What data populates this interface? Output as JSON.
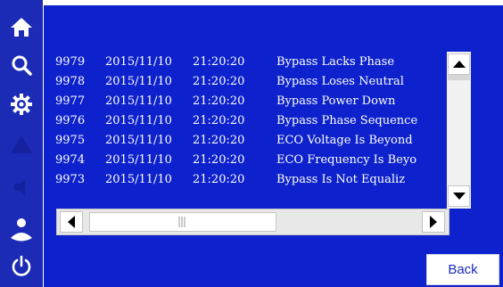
{
  "sidebar": {
    "items": [
      {
        "name": "home",
        "icon": "home-icon"
      },
      {
        "name": "search",
        "icon": "search-icon"
      },
      {
        "name": "settings",
        "icon": "gear-icon"
      },
      {
        "name": "alarm",
        "icon": "warning-icon"
      },
      {
        "name": "mute",
        "icon": "speaker-icon"
      },
      {
        "name": "user",
        "icon": "user-icon"
      },
      {
        "name": "power",
        "icon": "power-icon"
      }
    ]
  },
  "log": {
    "entries": [
      {
        "id": "9979",
        "date": "2015/11/10",
        "time": "21:20:20",
        "event": "Bypass Lacks Phase"
      },
      {
        "id": "9978",
        "date": "2015/11/10",
        "time": "21:20:20",
        "event": "Bypass Loses Neutral"
      },
      {
        "id": "9977",
        "date": "2015/11/10",
        "time": "21:20:20",
        "event": "Bypass Power Down"
      },
      {
        "id": "9976",
        "date": "2015/11/10",
        "time": "21:20:20",
        "event": "Bypass Phase Sequence"
      },
      {
        "id": "9975",
        "date": "2015/11/10",
        "time": "21:20:20",
        "event": "ECO Voltage Is Beyond"
      },
      {
        "id": "9974",
        "date": "2015/11/10",
        "time": "21:20:20",
        "event": "ECO Frequency Is Beyo"
      },
      {
        "id": "9973",
        "date": "2015/11/10",
        "time": "21:20:20",
        "event": "Bypass Is Not Equaliz"
      }
    ]
  },
  "footer": {
    "back_label": "Back"
  },
  "colors": {
    "sidebar": "#1b2bb5",
    "panel": "#0d22cc",
    "text": "#ffffff",
    "button_text": "#1a2bb8"
  }
}
